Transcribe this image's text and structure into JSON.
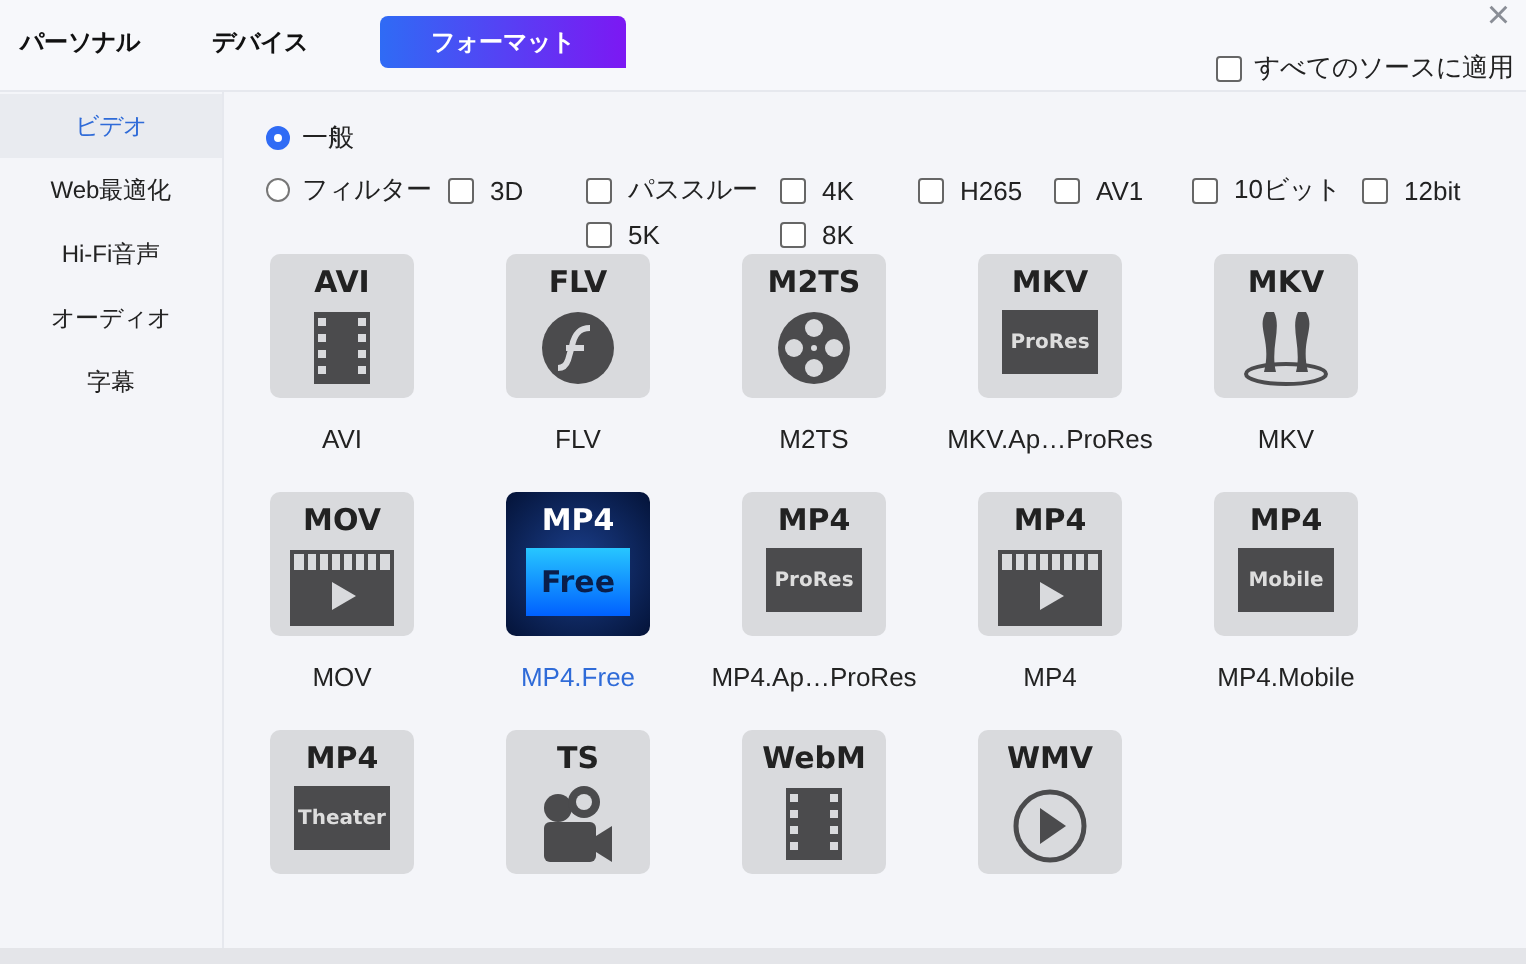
{
  "tabs": [
    {
      "label": "パーソナル",
      "selected": false
    },
    {
      "label": "デバイス",
      "selected": false
    },
    {
      "label": "フォーマット",
      "selected": true
    }
  ],
  "close": "×",
  "apply_all": {
    "label": "すべてのソースに適用",
    "checked": false
  },
  "sidebar": {
    "items": [
      {
        "label": "ビデオ",
        "selected": true
      },
      {
        "label": "Web最適化",
        "selected": false
      },
      {
        "label": "Hi-Fi音声",
        "selected": false
      },
      {
        "label": "オーディオ",
        "selected": false
      },
      {
        "label": "字幕",
        "selected": false
      }
    ]
  },
  "modes": [
    {
      "label": "一般",
      "selected": true
    },
    {
      "label": "フィルター",
      "selected": false
    }
  ],
  "filter_columns": [
    {
      "options": [
        {
          "label": "3D",
          "checked": false
        }
      ]
    },
    {
      "options": [
        {
          "label": "パススルー",
          "checked": false
        },
        {
          "label": "5K",
          "checked": false
        }
      ]
    },
    {
      "options": [
        {
          "label": "4K",
          "checked": false
        },
        {
          "label": "8K",
          "checked": false
        }
      ]
    },
    {
      "options": [
        {
          "label": "H265",
          "checked": false
        }
      ]
    },
    {
      "options": [
        {
          "label": "AV1",
          "checked": false
        }
      ]
    },
    {
      "options": [
        {
          "label": "10ビット",
          "checked": false
        }
      ]
    },
    {
      "options": [
        {
          "label": "12bit",
          "checked": false
        }
      ]
    }
  ],
  "formats": [
    {
      "name": "AVI",
      "tile_title": "AVI",
      "kind": "film",
      "selected": false
    },
    {
      "name": "FLV",
      "tile_title": "FLV",
      "kind": "flash",
      "selected": false
    },
    {
      "name": "M2TS",
      "tile_title": "M2TS",
      "kind": "reel",
      "selected": false
    },
    {
      "name": "MKV.Ap…ProRes",
      "tile_title": "MKV",
      "kind": "badge",
      "badge": "ProRes",
      "selected": false
    },
    {
      "name": "MKV",
      "tile_title": "MKV",
      "kind": "stage",
      "selected": false
    },
    {
      "name": "MOV",
      "tile_title": "MOV",
      "kind": "clapper",
      "selected": false
    },
    {
      "name": "MP4.Free",
      "tile_title": "MP4",
      "kind": "badge",
      "badge": "Free",
      "selected": true
    },
    {
      "name": "MP4.Ap…ProRes",
      "tile_title": "MP4",
      "kind": "badge",
      "badge": "ProRes",
      "selected": false
    },
    {
      "name": "MP4",
      "tile_title": "MP4",
      "kind": "clapper",
      "selected": false
    },
    {
      "name": "MP4.Mobile",
      "tile_title": "MP4",
      "kind": "badge",
      "badge": "Mobile",
      "selected": false
    },
    {
      "tile_title": "MP4",
      "kind": "badge",
      "badge": "Theater",
      "selected": false
    },
    {
      "tile_title": "TS",
      "kind": "camera",
      "selected": false
    },
    {
      "tile_title": "WebM",
      "kind": "film",
      "selected": false
    },
    {
      "tile_title": "WMV",
      "kind": "play",
      "selected": false
    }
  ]
}
